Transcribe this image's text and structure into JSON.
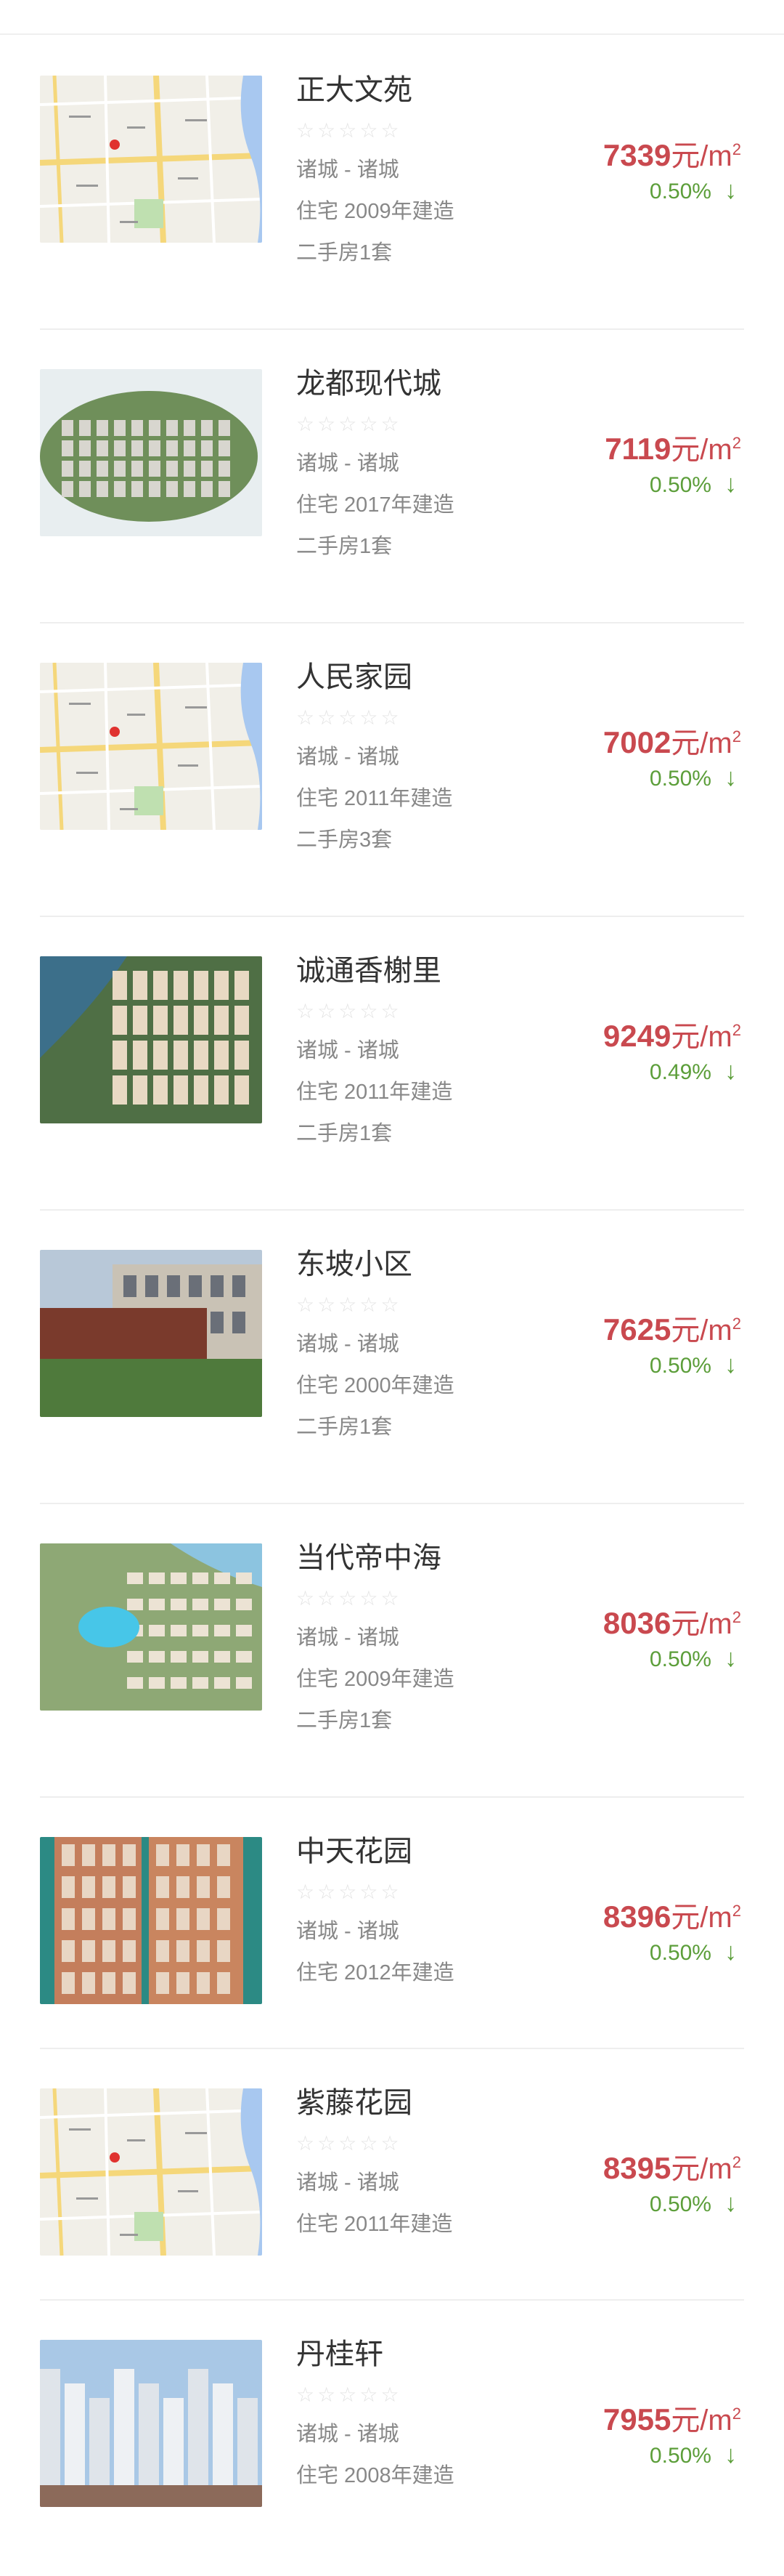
{
  "colors": {
    "price": "#c9494f",
    "change": "#5c9e3a",
    "star": "#e3e3e3"
  },
  "star_icon": "star-outline-icon",
  "arrow_icon": "arrow-down-icon",
  "items": [
    {
      "name": "正大文苑",
      "location": "诸城 - 诸城",
      "type_year": "住宅  2009年建造",
      "second_hand": "二手房1套",
      "price": "7339",
      "unit": "元/m",
      "sup": "2",
      "change": "0.50%",
      "arrow": "↓",
      "thumb": "map"
    },
    {
      "name": "龙都现代城",
      "location": "诸城 - 诸城",
      "type_year": "住宅  2017年建造",
      "second_hand": "二手房1套",
      "price": "7119",
      "unit": "元/m",
      "sup": "2",
      "change": "0.50%",
      "arrow": "↓",
      "thumb": "aerial-green"
    },
    {
      "name": "人民家园",
      "location": "诸城 - 诸城",
      "type_year": "住宅  2011年建造",
      "second_hand": "二手房3套",
      "price": "7002",
      "unit": "元/m",
      "sup": "2",
      "change": "0.50%",
      "arrow": "↓",
      "thumb": "map"
    },
    {
      "name": "诚通香榭里",
      "location": "诸城 - 诸城",
      "type_year": "住宅  2011年建造",
      "second_hand": "二手房1套",
      "price": "9249",
      "unit": "元/m",
      "sup": "2",
      "change": "0.49%",
      "arrow": "↓",
      "thumb": "aerial-blue"
    },
    {
      "name": "东坡小区",
      "location": "诸城 - 诸城",
      "type_year": "住宅  2000年建造",
      "second_hand": "二手房1套",
      "price": "7625",
      "unit": "元/m",
      "sup": "2",
      "change": "0.50%",
      "arrow": "↓",
      "thumb": "gate"
    },
    {
      "name": "当代帝中海",
      "location": "诸城 - 诸城",
      "type_year": "住宅  2009年建造",
      "second_hand": "二手房1套",
      "price": "8036",
      "unit": "元/m",
      "sup": "2",
      "change": "0.50%",
      "arrow": "↓",
      "thumb": "aerial-pool"
    },
    {
      "name": "中天花园",
      "location": "诸城 - 诸城",
      "type_year": "住宅  2012年建造",
      "second_hand": "",
      "price": "8396",
      "unit": "元/m",
      "sup": "2",
      "change": "0.50%",
      "arrow": "↓",
      "thumb": "tower"
    },
    {
      "name": "紫藤花园",
      "location": "诸城 - 诸城",
      "type_year": "住宅  2011年建造",
      "second_hand": "",
      "price": "8395",
      "unit": "元/m",
      "sup": "2",
      "change": "0.50%",
      "arrow": "↓",
      "thumb": "map"
    },
    {
      "name": "丹桂轩",
      "location": "诸城 - 诸城",
      "type_year": "住宅  2008年建造",
      "second_hand": "",
      "price": "7955",
      "unit": "元/m",
      "sup": "2",
      "change": "0.50%",
      "arrow": "↓",
      "thumb": "buildings"
    }
  ]
}
